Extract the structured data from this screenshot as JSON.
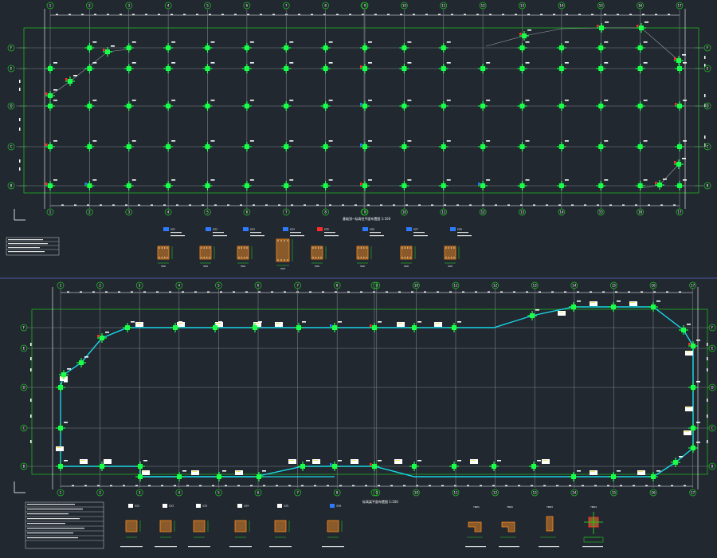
{
  "colors": {
    "background": "#212830",
    "grid": "#7a7f86",
    "dimension_green": "#22c522",
    "column": "#1aff4a",
    "beam_cyan": "#19d6e6",
    "label_white": "#ffffff",
    "label_yellow": "#f2e85c",
    "section_fill": "#8a5a2a",
    "rebar_orange": "#ff8a1f",
    "mark_red": "#ff2a2a",
    "mark_blue": "#2e7bff",
    "separator": "#4a5aa0"
  },
  "grid_labels": {
    "columns_top": [
      "1",
      "2",
      "3",
      "4",
      "5",
      "6",
      "7",
      "8",
      "9",
      "10",
      "11",
      "12",
      "13",
      "14",
      "15",
      "16",
      "17"
    ],
    "rows_top": [
      "F",
      "E",
      "D",
      "C",
      "B"
    ],
    "columns_bottom": [
      "1",
      "2",
      "3",
      "4",
      "5",
      "6",
      "7",
      "8",
      "9",
      "10",
      "11",
      "12",
      "13",
      "14",
      "15",
      "16",
      "17"
    ],
    "rows_bottom": [
      "F",
      "E",
      "D",
      "C",
      "B"
    ]
  },
  "plan_top": {
    "title": "基础顶~标高柱平面布置图 1:100"
  },
  "plan_bottom": {
    "title": "标高梁平面布置图 1:100"
  },
  "section_labels_top": [
    "KZ1",
    "KZ2",
    "KZ3",
    "KZ4",
    "KZ5",
    "KZ6",
    "KZ7",
    "KZ8"
  ],
  "section_labels_bottom": [
    "GZ1",
    "GZ2",
    "GZ3",
    "GZ4",
    "GZ5",
    "GZ6"
  ],
  "section_labels_right": [
    "YBZ1",
    "YBZ2",
    "YBZ3",
    "YBZ4"
  ],
  "section_dim": "500"
}
